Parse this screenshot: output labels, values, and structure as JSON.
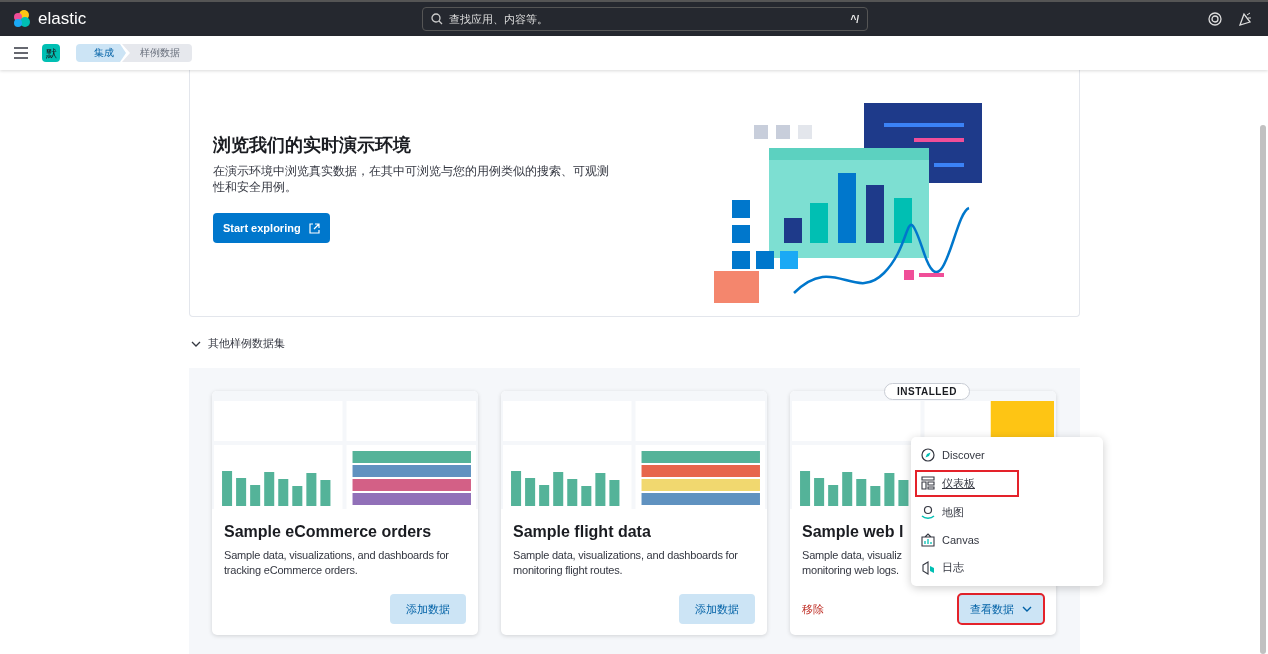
{
  "header": {
    "logo_text": "elastic",
    "search": {
      "placeholder": "查找应用、内容等。",
      "shortcut": "^/"
    }
  },
  "breadcrumb_bar": {
    "space_badge": "默",
    "crumbs": [
      {
        "label": "集成",
        "selected": false
      },
      {
        "label": "样例数据",
        "selected": true
      }
    ]
  },
  "demo_panel": {
    "title": "浏览我们的实时演示环境",
    "description": "在演示环境中浏览真实数据，在其中可浏览与您的用例类似的搜索、可观测性和安全用例。",
    "button": "Start exploring"
  },
  "other_datasets": {
    "label": "其他样例数据集",
    "expanded": true
  },
  "cards": [
    {
      "kind": "picture",
      "title": "Sample eCommerce orders",
      "description": "Sample data, visualizations, and dashboards for tracking eCommerce orders.",
      "installed": false,
      "primary_button": {
        "label": "添加数据",
        "highlighted": false
      }
    },
    {
      "kind": "picture",
      "title": "Sample flight data",
      "description": "Sample data, visualizations, and dashboards for monitoring flight routes.",
      "installed": false,
      "primary_button": {
        "label": "添加数据",
        "highlighted": false
      }
    },
    {
      "kind": "picture",
      "title": "Sample web l",
      "description": "Sample data, visualiz",
      "description_2": "monitoring web logs.",
      "installed": true,
      "badge": "INSTALLED",
      "remove_button": "移除",
      "primary_button": {
        "label": "查看数据",
        "highlighted": true
      }
    }
  ],
  "view_menu": {
    "items": [
      {
        "kind": "compass",
        "label": "Discover",
        "highlighted": false
      },
      {
        "kind": "dashboard",
        "label": "仪表板",
        "highlighted": true
      },
      {
        "kind": "map",
        "label": "地图",
        "highlighted": false
      },
      {
        "kind": "canvas",
        "label": "Canvas",
        "highlighted": false
      },
      {
        "kind": "logs",
        "label": "日志",
        "highlighted": false
      }
    ]
  }
}
